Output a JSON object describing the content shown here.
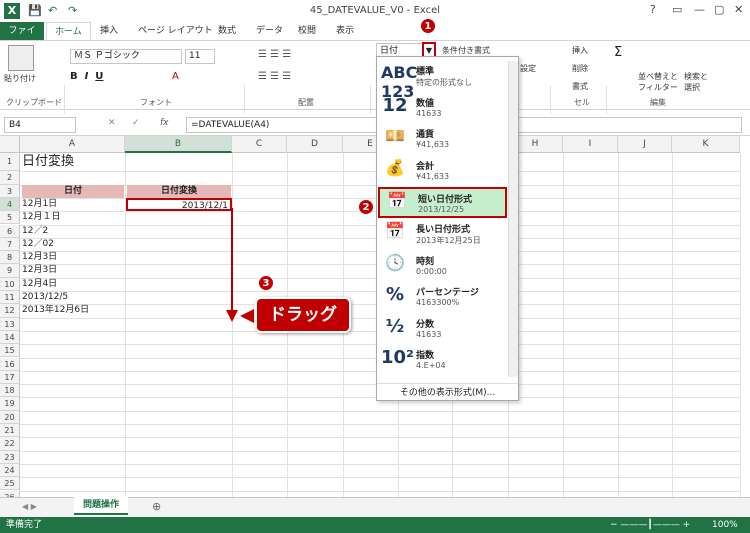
{
  "app": {
    "title": "45_DATEVALUE_V0 - Excel",
    "logo": "X"
  },
  "tabs": [
    "ファイル",
    "ホーム",
    "挿入",
    "ページ レイアウト",
    "数式",
    "データ",
    "校閲",
    "表示"
  ],
  "ribbon": {
    "paste": "貼り付け",
    "clipboard": "クリップボード",
    "font_name": "ＭＳ Ｐゴシック",
    "font_size": "11",
    "font_group": "フォント",
    "align_group": "配置",
    "number_format": "日付",
    "cond_format": "条件付き書式",
    "insert": "挿入",
    "delete": "削除",
    "format": "書式",
    "cells_group": "セル",
    "settings": "設定",
    "sort": "並べ替えと",
    "sort2": "フィルター",
    "find": "検索と",
    "find2": "選択",
    "edit_group": "編集"
  },
  "formula_bar": {
    "name_box": "B4",
    "fx": "fx",
    "formula": "=DATEVALUE(A4)"
  },
  "columns": [
    "A",
    "B",
    "C",
    "D",
    "E",
    "F",
    "G",
    "H",
    "I",
    "J",
    "K"
  ],
  "rows": [
    "1",
    "2",
    "3",
    "4",
    "5",
    "6",
    "7",
    "8",
    "9",
    "10",
    "11",
    "12",
    "13",
    "14",
    "15",
    "16",
    "17",
    "18",
    "19",
    "20",
    "21",
    "22",
    "23",
    "24",
    "25",
    "26"
  ],
  "cells": {
    "a1": "日付変換",
    "a3": "日付",
    "b3": "日付変換",
    "b4": "2013/12/1",
    "a4": "12月1日",
    "a5": "12月１日",
    "a6": "12／2",
    "a7": "12／02",
    "a8": "12月3日",
    "a9": "12月3日",
    "a10": "12月4日",
    "a11": "2013/12/5",
    "a12": "2013年12月6日"
  },
  "format_options": [
    {
      "icon": "ABC 123",
      "name": "標準",
      "example": "特定の形式なし"
    },
    {
      "icon": "12",
      "name": "数値",
      "example": "41633"
    },
    {
      "icon": "currency-icon",
      "name": "通貨",
      "example": "¥41,633"
    },
    {
      "icon": "accounting-icon",
      "name": "会計",
      "example": " ¥41,633"
    },
    {
      "icon": "calendar-icon",
      "name": "短い日付形式",
      "example": "2013/12/25"
    },
    {
      "icon": "calendar-icon",
      "name": "長い日付形式",
      "example": "2013年12月25日"
    },
    {
      "icon": "clock-icon",
      "name": "時刻",
      "example": "0:00:00"
    },
    {
      "icon": "%",
      "name": "パーセンテージ",
      "example": "4163300%"
    },
    {
      "icon": "½",
      "name": "分数",
      "example": "41633"
    },
    {
      "icon": "10²",
      "name": "指数",
      "example": "4.E+04"
    }
  ],
  "more_formats": "その他の表示形式(M)...",
  "annotations": {
    "c1": "1",
    "c2": "2",
    "c3": "3",
    "drag": "ドラッグ"
  },
  "sheet_tab": "問題操作",
  "status": "準備完了",
  "zoom": "100%",
  "colors": {
    "excel_green": "#217346",
    "highlight_red": "#c00000",
    "header_fill": "#e6b9b8",
    "selected_fill": "#c6efce"
  }
}
